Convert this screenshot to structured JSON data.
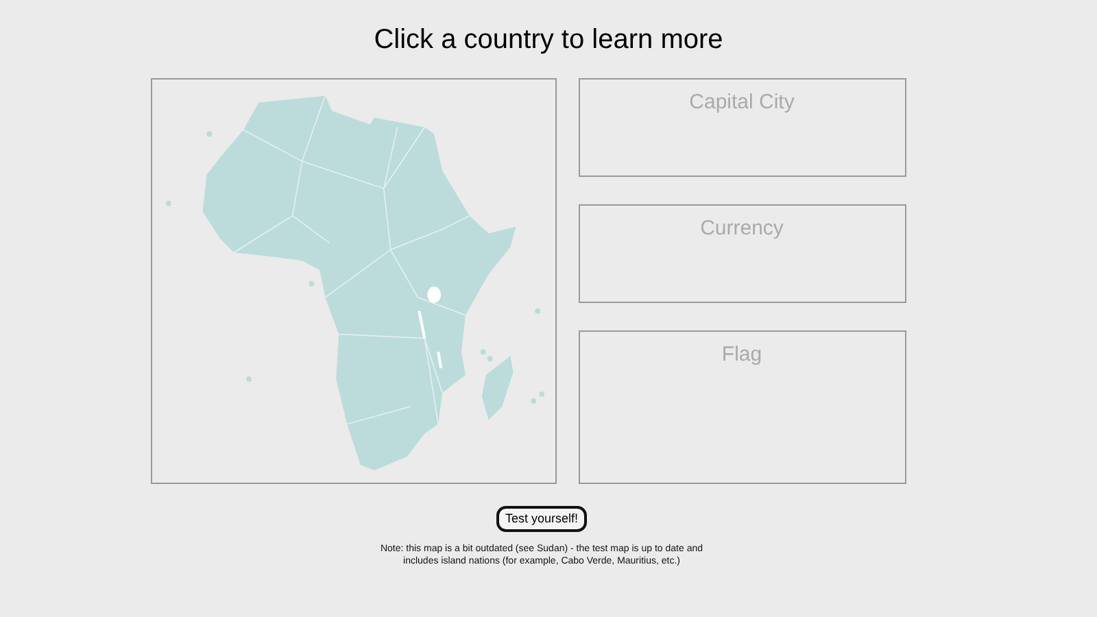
{
  "title": "Click a country to learn more",
  "panels": [
    {
      "label": "Capital City"
    },
    {
      "label": "Currency"
    },
    {
      "label": "Flag"
    }
  ],
  "button": "Test yourself!",
  "note": "Note: this map is a bit outdated (see Sudan) - the test map is up to date and includes island nations (for example, Cabo Verde, Mauritius, etc.)"
}
